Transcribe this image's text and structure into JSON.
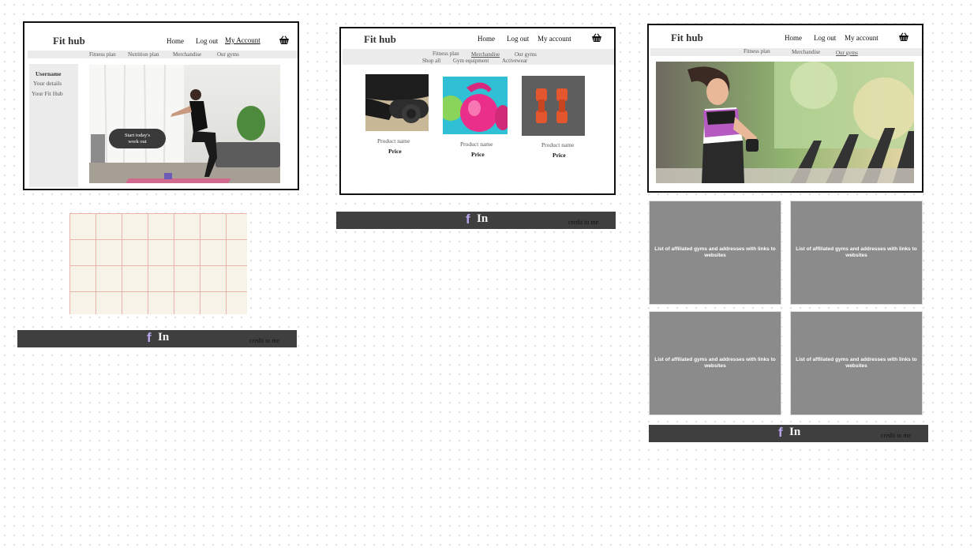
{
  "brand": "Fit hub",
  "frame1": {
    "nav": {
      "home": "Home",
      "logout": "Log out",
      "account": "My Account"
    },
    "subnav": [
      "Fitness plan",
      "Nutrition plan",
      "Merchandise",
      "Our gyms"
    ],
    "sidebar": {
      "username": "Username",
      "details": "Your details",
      "fithub": "Your Fit Hub"
    },
    "cta": {
      "line1": "Start today's",
      "line2": "work out"
    }
  },
  "frame2": {
    "nav": {
      "home": "Home",
      "logout": "Log out",
      "account": "My account"
    },
    "subnav": [
      "Fitness plan",
      "Merchandise",
      "Our gyms"
    ],
    "subnav2": [
      "Shop all",
      "Gym equipment",
      "Activewear"
    ],
    "products": [
      {
        "name": "Product name",
        "price": "Price"
      },
      {
        "name": "Product name",
        "price": "Price"
      },
      {
        "name": "Product name",
        "price": "Price"
      }
    ]
  },
  "frame3": {
    "nav": {
      "home": "Home",
      "logout": "Log out",
      "account": "My account"
    },
    "subnav": [
      "Fitness plan",
      "Merchandise",
      "Our gyms"
    ],
    "cards": [
      "List of affiliated gyms and addresses with links to websites",
      "List of affiliated gyms and addresses with links to websites",
      "List of affiliated gyms and addresses with links to websites",
      "List of affiliated gyms and addresses with links to websites"
    ]
  },
  "footer": {
    "fb": "f",
    "in": "In",
    "credit": "credit to me"
  },
  "colors": {
    "footer_bg": "#3f3f3f",
    "card_bg": "#8b8b8b",
    "fb_accent": "#b9a6ee"
  }
}
